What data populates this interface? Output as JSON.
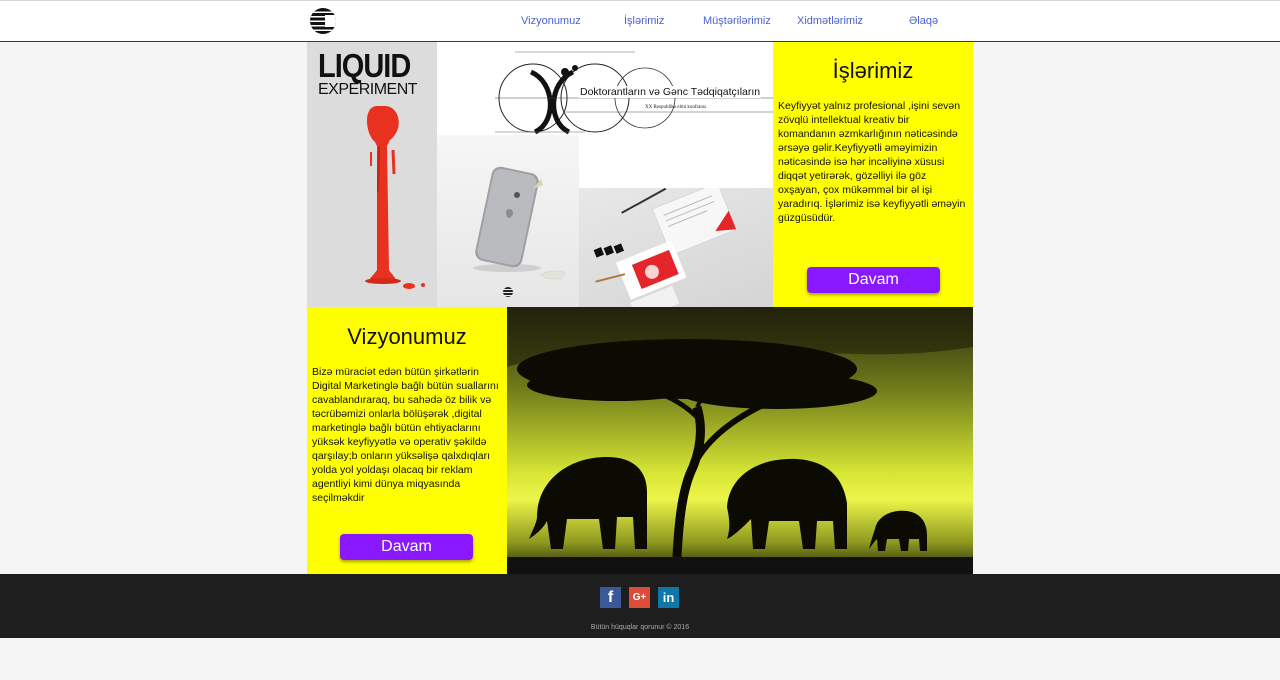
{
  "header": {
    "logo_icon": "c-stripes-logo-icon",
    "nav": [
      {
        "label": "Vizyonumuz"
      },
      {
        "label": "İşlərimiz"
      },
      {
        "label": "Müştərilərimiz"
      },
      {
        "label": "Xidmətlərimiz"
      },
      {
        "label": "Əlaqə"
      }
    ]
  },
  "gallery": {
    "liquid": {
      "title_line1": "LIQUID",
      "title_line2": "EXPERIMENT"
    },
    "conference": {
      "title": "Doktorantların və Gənc Tədqiqatçıların",
      "subtitle": "XX Respublika elmi konfransı"
    }
  },
  "works": {
    "title": "İşlərimiz",
    "text": "Keyfiyyət yalnız profesional ,işini sevən zövqlü intellektual kreativ bir komandanın əzmkarlığının nəticəsində ərsəyə gəlir.Keyfiyyətli əməyimizin nəticəsində isə hər incəliyinə xüsusi diqqət yetirərək, gözəlliyi ilə göz oxşayan, çox mükəmməl bir əl işi yaradırıq. İşlərimiz isə keyfiyyətli əməyin güzgüsüdür.",
    "button": "Davam"
  },
  "vision": {
    "title": "Vizyonumuz",
    "text": "Bizə müraciət edən bütün şirkətlərin Digital Marketinglə bağlı bütün suallarını cavablandıraraq, bu sahədə öz bilik və təcrübəmizi onlarla bölüşərək ,digital marketinglə bağlı bütün ehtiyaclarını yüksək keyfiyyətlə və operativ şəkildə qarşılay;b onların yüksəlişə qalxdıqları yolda yol yoldaşı olacaq bir reklam agentliyi kimi dünya miqyasında seçilməkdir",
    "button": "Davam"
  },
  "footer": {
    "social": [
      {
        "icon": "facebook-icon",
        "glyph": "f",
        "color": "#3b5998"
      },
      {
        "icon": "google-plus-icon",
        "glyph": "G+",
        "color": "#dd4b39"
      },
      {
        "icon": "linkedin-icon",
        "glyph": "in",
        "color": "#0e76a8"
      }
    ],
    "copyright": "Bütün hüquqlar qorunur © 2016"
  },
  "colors": {
    "accent_yellow": "#ffff00",
    "button_purple": "#8a18ff",
    "footer_bg": "#1e1e1e",
    "nav_link": "#4a5fd0"
  }
}
